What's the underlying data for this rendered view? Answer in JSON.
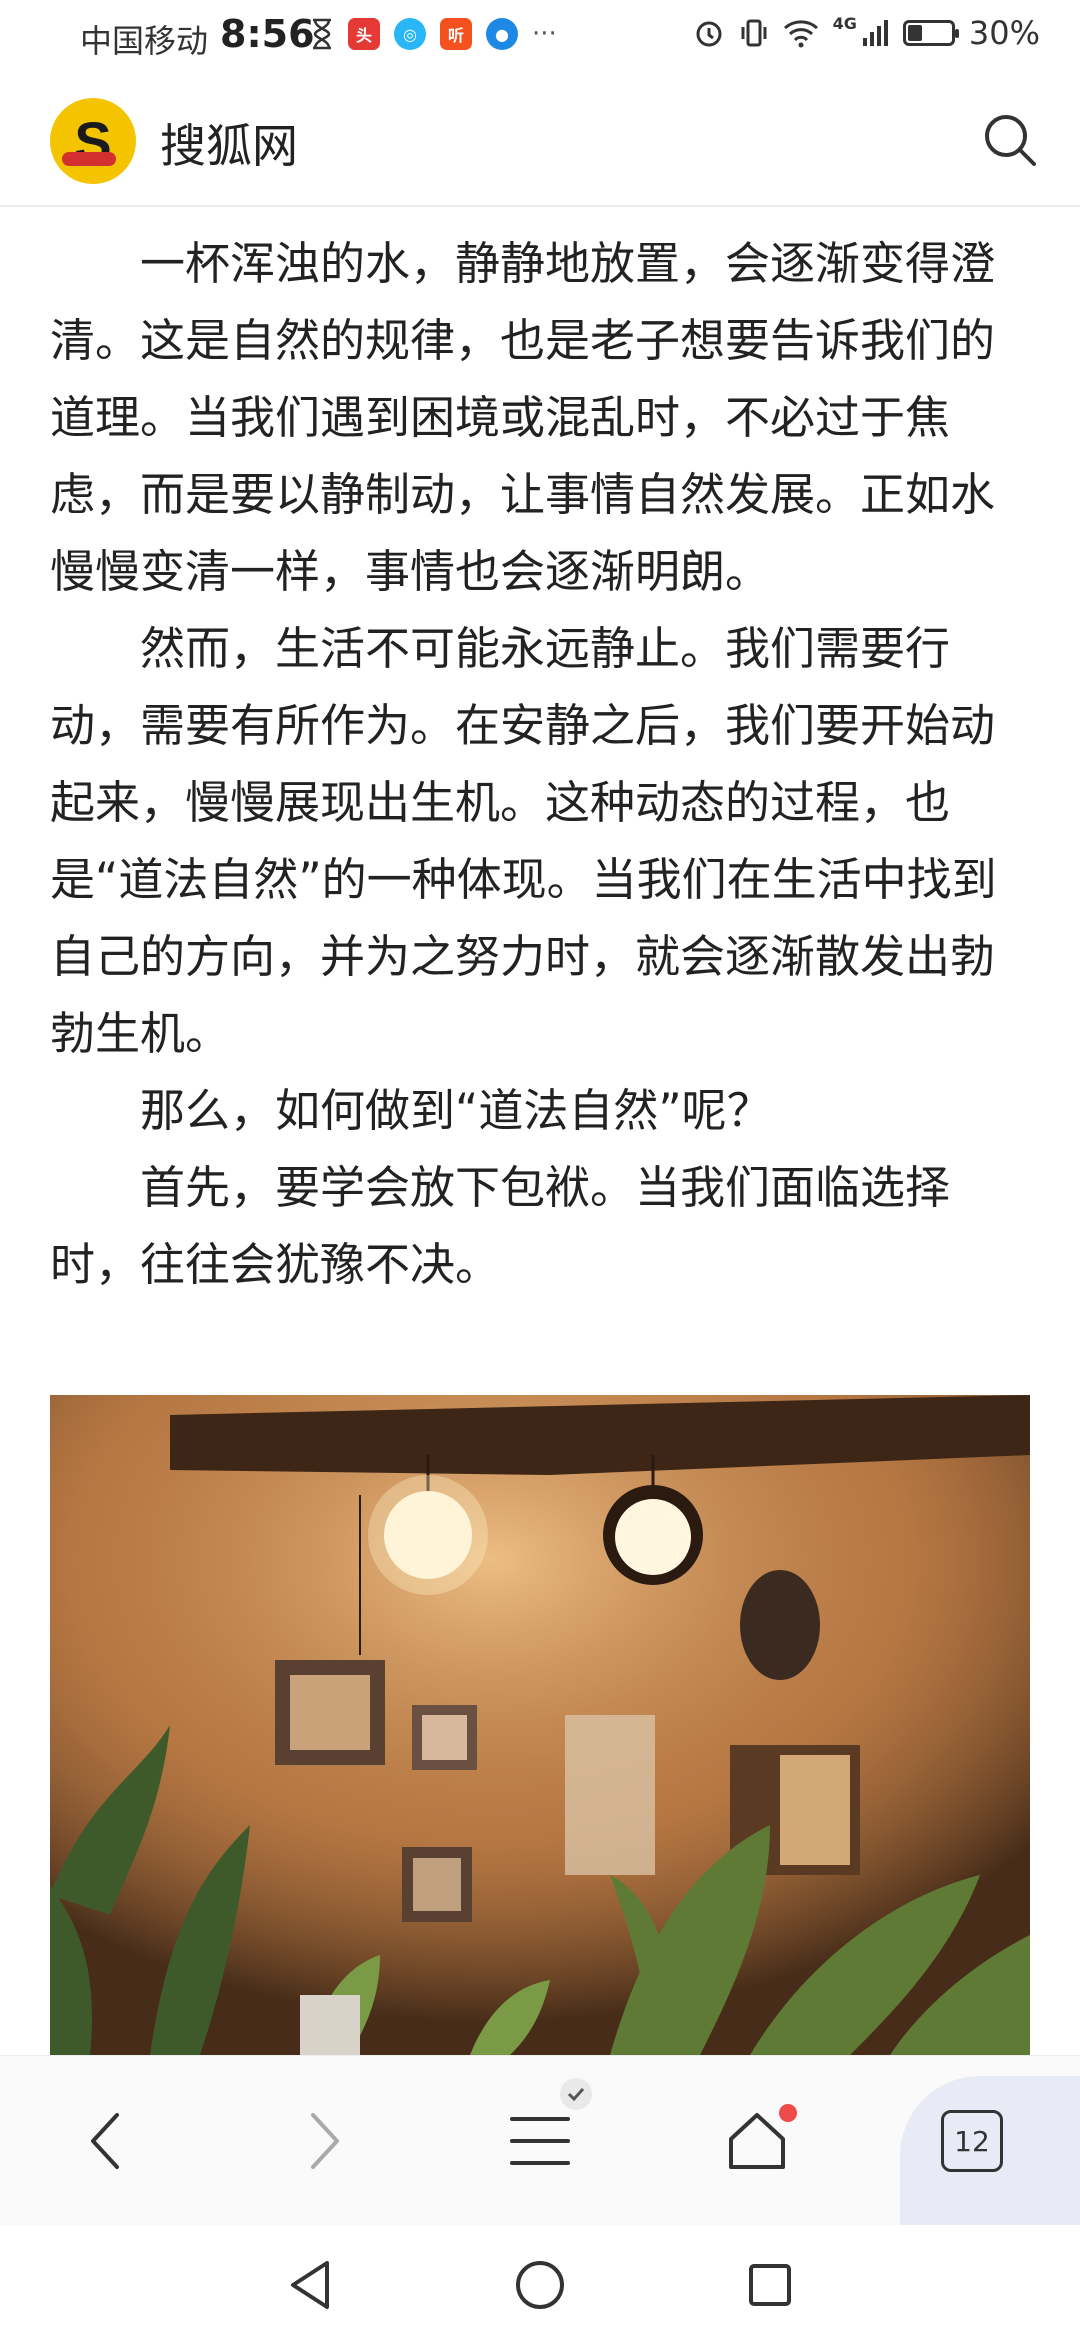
{
  "status_bar": {
    "carrier": "中国移动",
    "time": "8:56",
    "battery": "30%",
    "network": "4G",
    "battery_level": 0.3
  },
  "header": {
    "site_name": "搜狐网",
    "logo_letter": "S"
  },
  "article": {
    "paragraphs": [
      "一杯浑浊的水，静静地放置，会逐渐变得澄清。这是自然的规律，也是老子想要告诉我们的道理。当我们遇到困境或混乱时，不必过于焦虑，而是要以静制动，让事情自然发展。正如水慢慢变清一样，事情也会逐渐明朗。",
      "然而，生活不可能永远静止。我们需要行动，需要有所作为。在安静之后，我们要开始动起来，慢慢展现出生机。这种动态的过程，也是“道法自然”的一种体现。当我们在生活中找到自己的方向，并为之努力时，就会逐渐散发出勃勃生机。",
      "那么，如何做到“道法自然”呢？",
      "首先，要学会放下包袱。当我们面临选择时，往往会犹豫不决。"
    ]
  },
  "browser_nav": {
    "tab_count": "12"
  },
  "colors": {
    "logo_yellow": "#f5c400",
    "logo_red": "#d32f2f",
    "badge_red": "#ef4a4a"
  }
}
